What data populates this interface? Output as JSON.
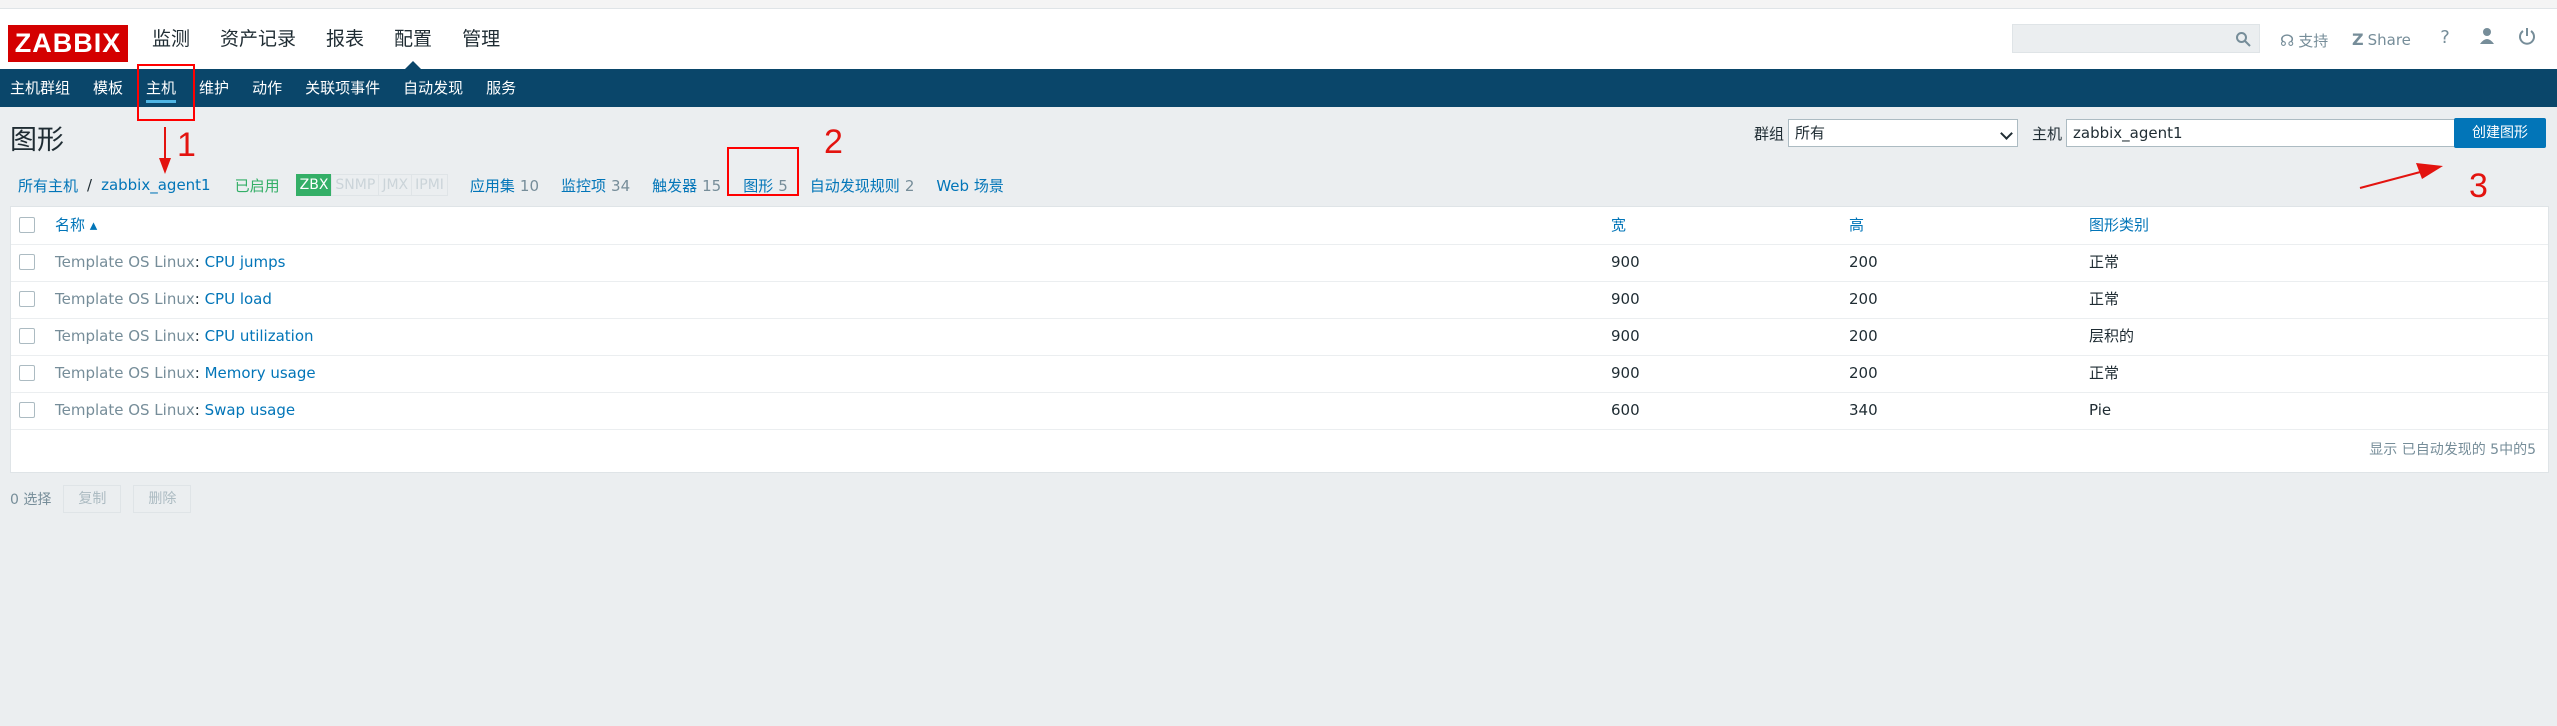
{
  "logo": "ZABBIX",
  "main_menu": [
    "监测",
    "资产记录",
    "报表",
    "配置",
    "管理"
  ],
  "main_menu_active": "配置",
  "top_links": {
    "support": "支持",
    "share": "Share",
    "help": "?"
  },
  "sub_menu": [
    "主机群组",
    "模板",
    "主机",
    "维护",
    "动作",
    "关联项事件",
    "自动发现",
    "服务"
  ],
  "sub_menu_active": "主机",
  "page_title": "图形",
  "filter": {
    "group_label": "群组",
    "group_value": "所有",
    "host_label": "主机",
    "host_value": "zabbix_agent1"
  },
  "create_button": "创建图形",
  "breadcrumb": {
    "all_hosts": "所有主机",
    "host": "zabbix_agent1",
    "status": "已启用"
  },
  "availability": [
    "ZBX",
    "SNMP",
    "JMX",
    "IPMI"
  ],
  "host_tabs": [
    {
      "label": "应用集",
      "count": "10"
    },
    {
      "label": "监控项",
      "count": "34"
    },
    {
      "label": "触发器",
      "count": "15"
    },
    {
      "label": "图形",
      "count": "5"
    },
    {
      "label": "自动发现规则",
      "count": "2"
    },
    {
      "label": "Web 场景",
      "count": ""
    }
  ],
  "table": {
    "headers": {
      "name": "名称 ▴",
      "width": "宽",
      "height": "高",
      "type": "图形类别"
    },
    "rows": [
      {
        "template": "Template OS Linux",
        "name": "CPU jumps",
        "width": "900",
        "height": "200",
        "type": "正常"
      },
      {
        "template": "Template OS Linux",
        "name": "CPU load",
        "width": "900",
        "height": "200",
        "type": "正常"
      },
      {
        "template": "Template OS Linux",
        "name": "CPU utilization",
        "width": "900",
        "height": "200",
        "type": "层积的"
      },
      {
        "template": "Template OS Linux",
        "name": "Memory usage",
        "width": "900",
        "height": "200",
        "type": "正常"
      },
      {
        "template": "Template OS Linux",
        "name": "Swap usage",
        "width": "600",
        "height": "340",
        "type": "Pie"
      }
    ],
    "footer": "显示 已自动发现的 5中的5"
  },
  "bottom": {
    "selected": "0 选择",
    "copy": "复制",
    "delete": "删除"
  },
  "annotations": [
    "1",
    "2",
    "3"
  ],
  "colors": {
    "logo_red": "#d40000",
    "nav_blue": "#0a466a",
    "link_blue": "#0275b8",
    "annotation_red": "#e3130f",
    "zbx_green": "#34af67"
  }
}
